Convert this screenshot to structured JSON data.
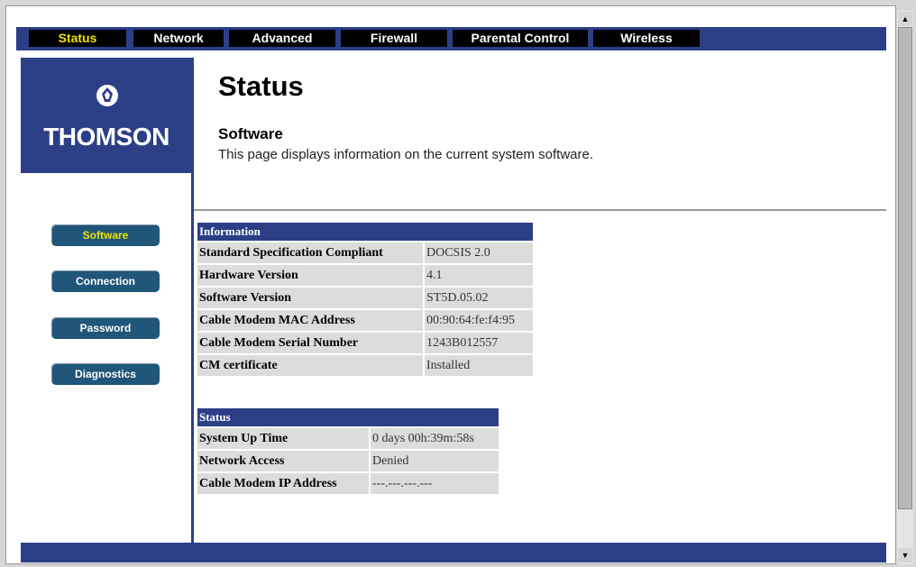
{
  "nav": {
    "tabs": [
      {
        "label": "Status"
      },
      {
        "label": "Network"
      },
      {
        "label": "Advanced"
      },
      {
        "label": "Firewall"
      },
      {
        "label": "Parental Control"
      },
      {
        "label": "Wireless"
      }
    ],
    "active_index": 0
  },
  "brand": {
    "name": "THOMSON",
    "icon": "thomson-logo-icon"
  },
  "sidebar": {
    "items": [
      {
        "label": "Software"
      },
      {
        "label": "Connection"
      },
      {
        "label": "Password"
      },
      {
        "label": "Diagnostics"
      }
    ],
    "active_index": 0
  },
  "main": {
    "title": "Status",
    "section_title": "Software",
    "section_desc": "This page displays information on the current system software."
  },
  "information_table": {
    "header": "Information",
    "rows": [
      {
        "label": "Standard Specification Compliant",
        "value": "DOCSIS 2.0"
      },
      {
        "label": "Hardware Version",
        "value": "4.1"
      },
      {
        "label": "Software Version",
        "value": "ST5D.05.02"
      },
      {
        "label": "Cable Modem MAC Address",
        "value": "00:90:64:fe:f4:95"
      },
      {
        "label": "Cable Modem Serial Number",
        "value": "1243B012557"
      },
      {
        "label": "CM certificate",
        "value": "Installed"
      }
    ]
  },
  "status_table": {
    "header": "Status",
    "rows": [
      {
        "label": "System Up Time",
        "value": "0 days 00h:39m:58s"
      },
      {
        "label": "Network Access",
        "value": "Denied"
      },
      {
        "label": "Cable Modem IP Address",
        "value": "---.---.---.---"
      }
    ]
  },
  "colors": {
    "brand_blue": "#2c3f86",
    "button_blue": "#1f5679",
    "active_text": "#f2e200"
  }
}
